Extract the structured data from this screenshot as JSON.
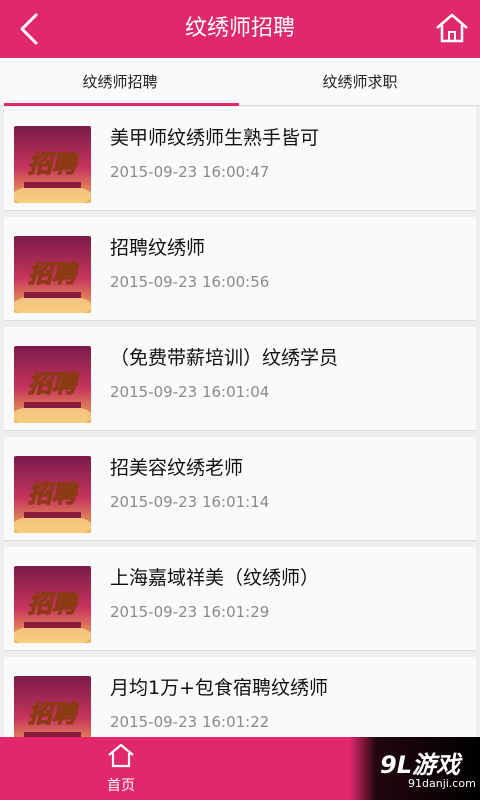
{
  "header": {
    "title": "纹绣师招聘",
    "back_icon": "chevron-left-icon",
    "home_icon": "home-icon"
  },
  "tabs": [
    {
      "label": "纹绣师招聘",
      "active": true
    },
    {
      "label": "纹绣师求职",
      "active": false
    }
  ],
  "thumbnail": {
    "text": "招聘"
  },
  "listings": [
    {
      "title": "美甲师纹绣师生熟手皆可",
      "date": "2015-09-23 16:00:47"
    },
    {
      "title": "招聘纹绣师",
      "date": "2015-09-23 16:00:56"
    },
    {
      "title": "（免费带薪培训）纹绣学员",
      "date": "2015-09-23 16:01:04"
    },
    {
      "title": "招美容纹绣老师",
      "date": "2015-09-23 16:01:14"
    },
    {
      "title": "上海嘉域祥美（纹绣师）",
      "date": "2015-09-23 16:01:29"
    },
    {
      "title": "月均1万+包食宿聘纹绣师",
      "date": "2015-09-23 16:01:22"
    }
  ],
  "bottom_nav": {
    "home_label": "首页"
  },
  "watermark": {
    "brand": "9L游戏",
    "domain": "91danji.com"
  },
  "colors": {
    "accent": "#e0286a",
    "background": "#eeeeee",
    "date_text": "#8a8a8a"
  }
}
